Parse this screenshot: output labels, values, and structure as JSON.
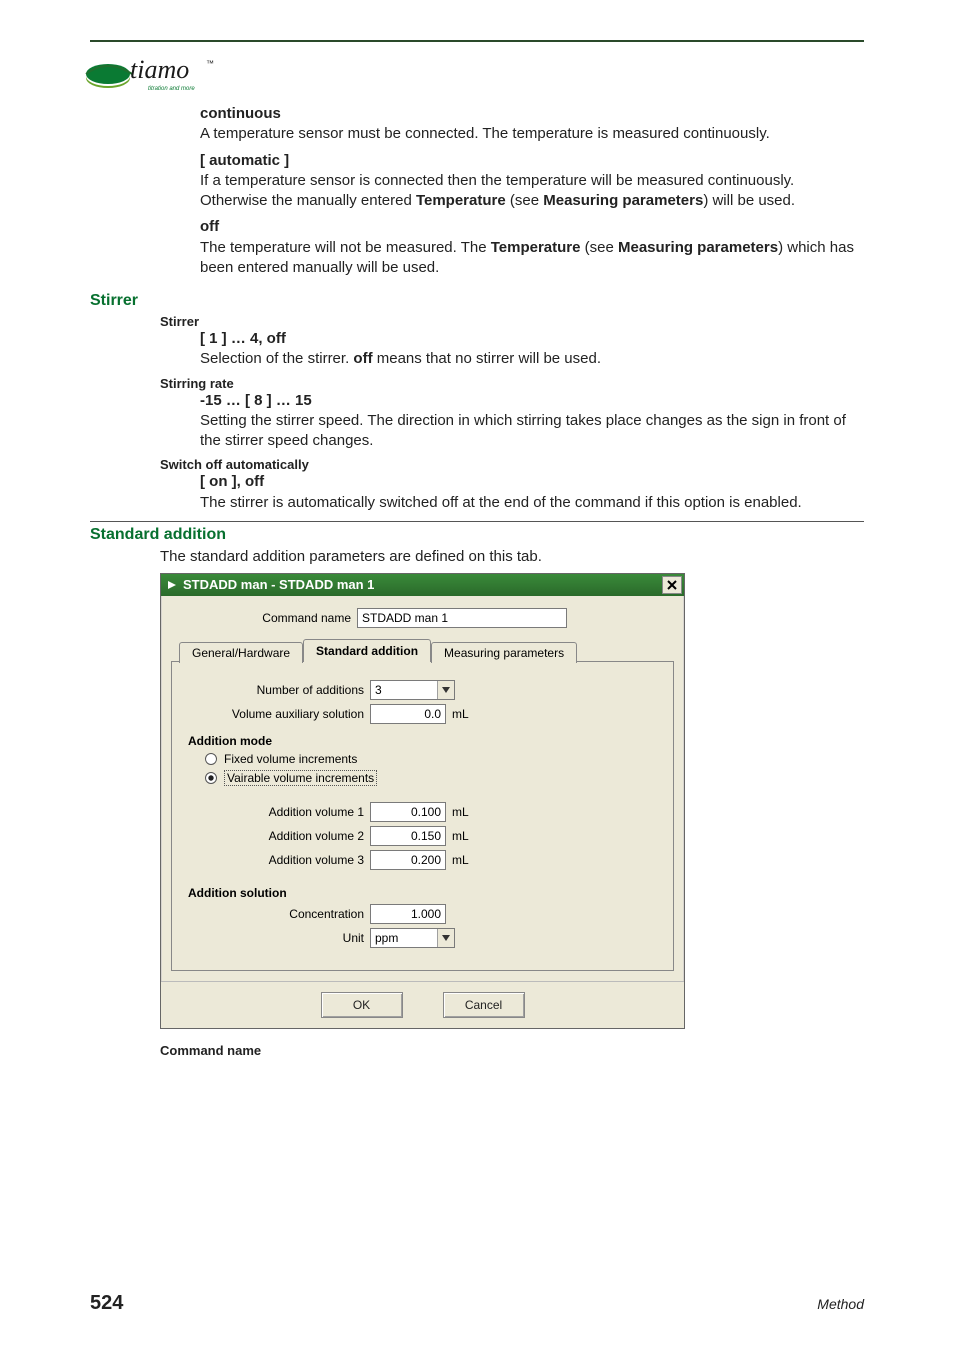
{
  "logo": {
    "brand": "tiamo",
    "tm": "™",
    "tagline": "titration and more"
  },
  "doc": {
    "continuous": {
      "title": "continuous",
      "text": "A temperature sensor must be connected. The temperature is measured continuously."
    },
    "automatic": {
      "title": "[ automatic ]",
      "text_a": "If a temperature sensor is connected then the temperature will be measured continuously. Otherwise the manually entered ",
      "kw1": "Temperature",
      "text_b": " (see ",
      "kw2": "Measuring parameters",
      "text_c": ") will be used."
    },
    "off": {
      "title": "off",
      "text_a": "The temperature will not be measured. The ",
      "kw1": "Temperature",
      "text_b": " (see ",
      "kw2": "Measuring parameters",
      "text_c": ") which has been entered manually will be used."
    }
  },
  "stirrer": {
    "heading": "Stirrer",
    "p_stirrer": {
      "label": "Stirrer",
      "range": "[ 1 ] … 4, off",
      "text_a": "Selection of the stirrer. ",
      "kw": "off",
      "text_b": " means that no stirrer will be used."
    },
    "p_rate": {
      "label": "Stirring rate",
      "range": "-15 … [ 8 ] … 15",
      "text": "Setting the stirrer speed. The direction in which stirring takes place changes as the sign in front of the stirrer speed changes."
    },
    "p_switch": {
      "label": "Switch off automatically",
      "range": "[ on ], off",
      "text": "The stirrer is automatically switched off at the end of the command if this option is enabled."
    }
  },
  "stdadd": {
    "heading": "Standard addition",
    "intro": "The standard addition parameters are defined on this tab."
  },
  "dialog": {
    "title": "STDADD man - STDADD man 1",
    "cmd_name_label": "Command name",
    "cmd_name_value": "STDADD man 1",
    "tabs": {
      "general": "General/Hardware",
      "stdadd": "Standard addition",
      "meas": "Measuring parameters"
    },
    "num_additions": {
      "label": "Number of additions",
      "value": "3"
    },
    "vol_aux": {
      "label": "Volume auxiliary solution",
      "value": "0.0",
      "unit": "mL"
    },
    "addition_mode": {
      "title": "Addition mode",
      "fixed": "Fixed volume increments",
      "variable": "Vairable volume increments"
    },
    "vols": {
      "v1": {
        "label": "Addition volume 1",
        "value": "0.100",
        "unit": "mL"
      },
      "v2": {
        "label": "Addition volume 2",
        "value": "0.150",
        "unit": "mL"
      },
      "v3": {
        "label": "Addition volume 3",
        "value": "0.200",
        "unit": "mL"
      }
    },
    "solution": {
      "title": "Addition solution",
      "conc": {
        "label": "Concentration",
        "value": "1.000"
      },
      "unit": {
        "label": "Unit",
        "value": "ppm"
      }
    },
    "buttons": {
      "ok": "OK",
      "cancel": "Cancel"
    }
  },
  "post_label": "Command name",
  "footer": {
    "page": "524",
    "section": "Method"
  }
}
